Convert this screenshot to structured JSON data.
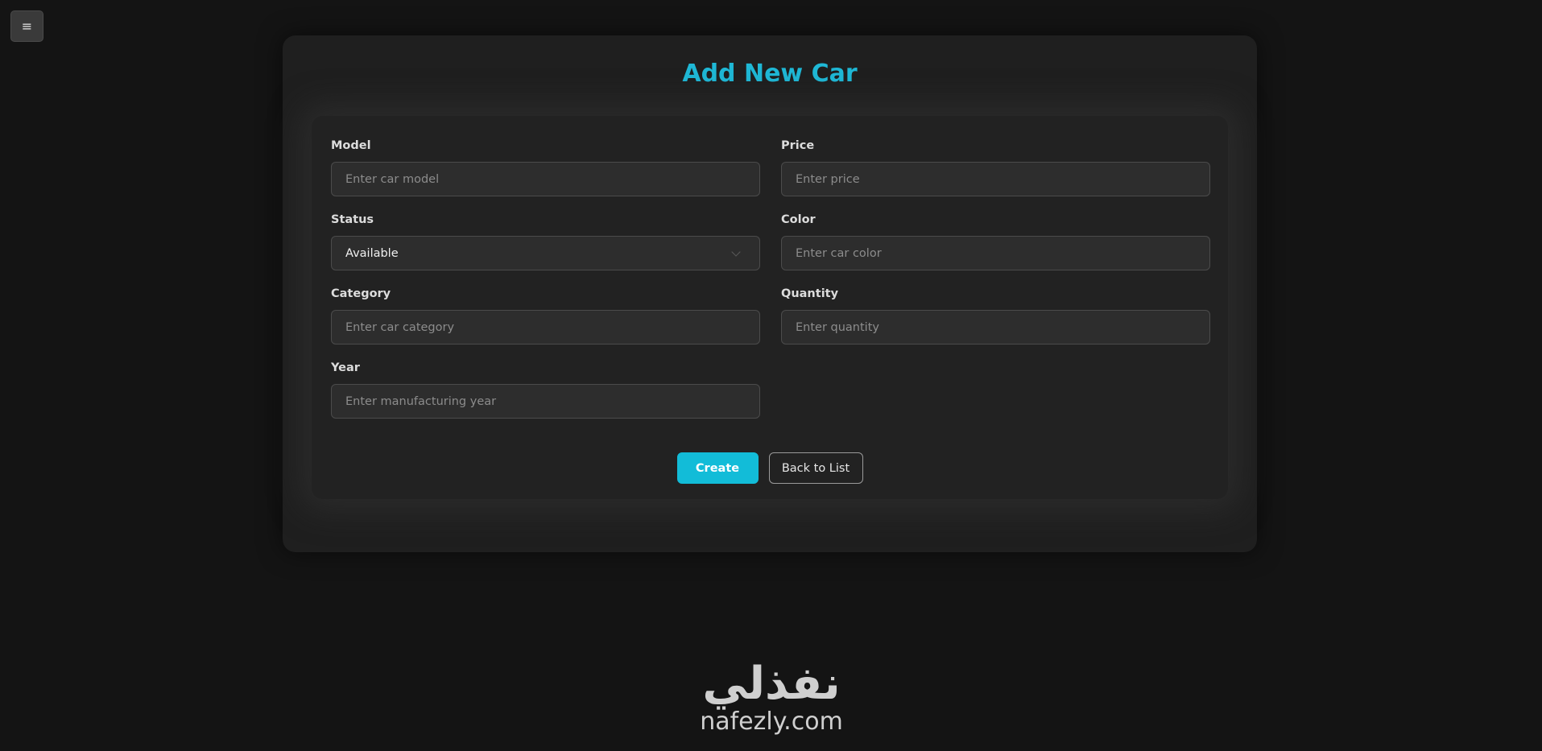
{
  "menu": {
    "icon": "hamburger-icon",
    "glyph": "≡"
  },
  "page": {
    "title": "Add New Car"
  },
  "form": {
    "model": {
      "label": "Model",
      "placeholder": "Enter car model"
    },
    "price": {
      "label": "Price",
      "placeholder": "Enter price"
    },
    "status": {
      "label": "Status",
      "value": "Available"
    },
    "color": {
      "label": "Color",
      "placeholder": "Enter car color"
    },
    "category": {
      "label": "Category",
      "placeholder": "Enter car category"
    },
    "quantity": {
      "label": "Quantity",
      "placeholder": "Enter quantity"
    },
    "year": {
      "label": "Year",
      "placeholder": "Enter manufacturing year"
    }
  },
  "actions": {
    "create_label": "Create",
    "back_label": "Back to List"
  },
  "footer": {
    "logo_mark": "نفذلي",
    "logo_text": "nafezly.com"
  },
  "colors": {
    "accent": "#12bcd8",
    "background": "#141414",
    "card": "#1f1f1f"
  }
}
